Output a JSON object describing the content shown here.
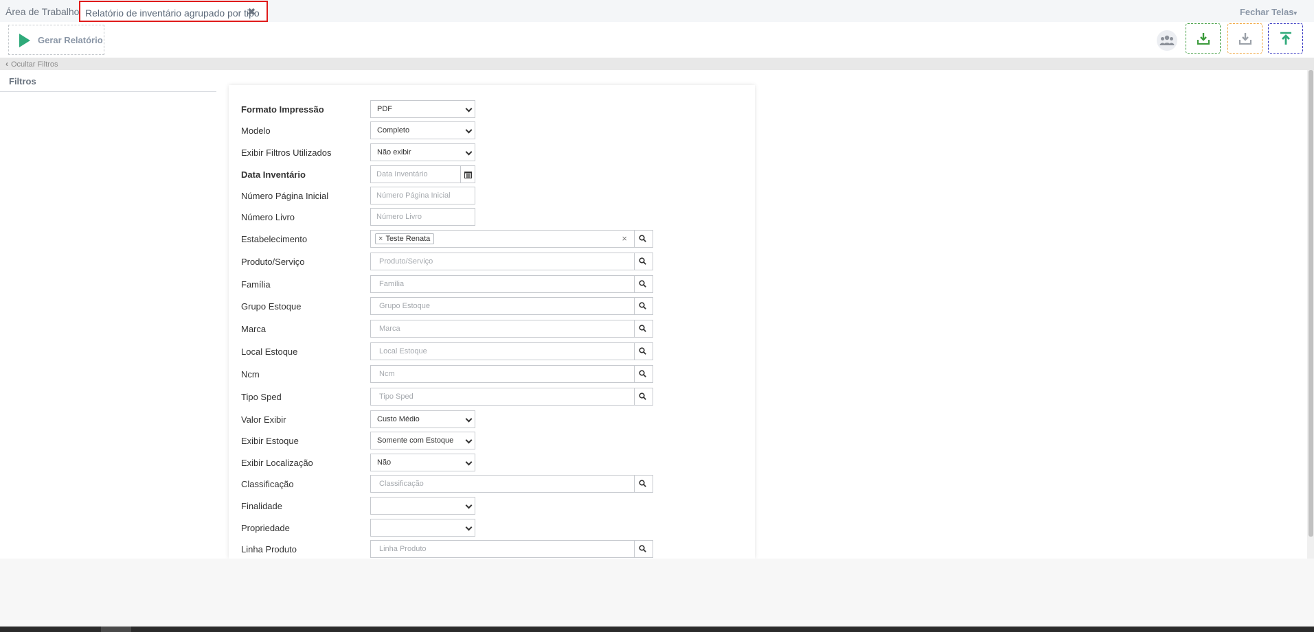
{
  "tabs": {
    "home": "Área de Trabalho",
    "active": "Relatório de inventário agrupado por tipo",
    "close_screens": "Fechar Telas"
  },
  "toolbar": {
    "generate_label": "Gerar Relatório",
    "colors": {
      "play": "#2faa7a",
      "download_green": "#3a9a3a",
      "download_gray": "#9aa0a8",
      "upload": "#2faa7a"
    }
  },
  "filters": {
    "toggle_label": "Ocultar Filtros",
    "title": "Filtros"
  },
  "form": {
    "print_format": {
      "label": "Formato Impressão",
      "value": "PDF"
    },
    "model": {
      "label": "Modelo",
      "value": "Completo"
    },
    "show_filters": {
      "label": "Exibir Filtros Utilizados",
      "value": "Não exibir"
    },
    "inventory_date": {
      "label": "Data Inventário",
      "placeholder": "Data Inventário"
    },
    "start_page": {
      "label": "Número Página Inicial",
      "placeholder": "Número Página Inicial"
    },
    "book_number": {
      "label": "Número Livro",
      "placeholder": "Número Livro"
    },
    "establishment": {
      "label": "Estabelecimento",
      "chip": "Teste Renata"
    },
    "product": {
      "label": "Produto/Serviço",
      "placeholder": "Produto/Serviço"
    },
    "family": {
      "label": "Família",
      "placeholder": "Família"
    },
    "stock_group": {
      "label": "Grupo Estoque",
      "placeholder": "Grupo Estoque"
    },
    "brand": {
      "label": "Marca",
      "placeholder": "Marca"
    },
    "stock_location": {
      "label": "Local Estoque",
      "placeholder": "Local Estoque"
    },
    "ncm": {
      "label": "Ncm",
      "placeholder": "Ncm"
    },
    "sped_type": {
      "label": "Tipo Sped",
      "placeholder": "Tipo Sped"
    },
    "value_display": {
      "label": "Valor Exibir",
      "value": "Custo Médio"
    },
    "show_stock": {
      "label": "Exibir Estoque",
      "value": "Somente com Estoque"
    },
    "show_location": {
      "label": "Exibir Localização",
      "value": "Não"
    },
    "classification": {
      "label": "Classificação",
      "placeholder": "Classificação"
    },
    "purpose": {
      "label": "Finalidade",
      "value": ""
    },
    "property": {
      "label": "Propriedade",
      "value": ""
    },
    "product_line": {
      "label": "Linha Produto",
      "placeholder": "Linha Produto"
    }
  }
}
